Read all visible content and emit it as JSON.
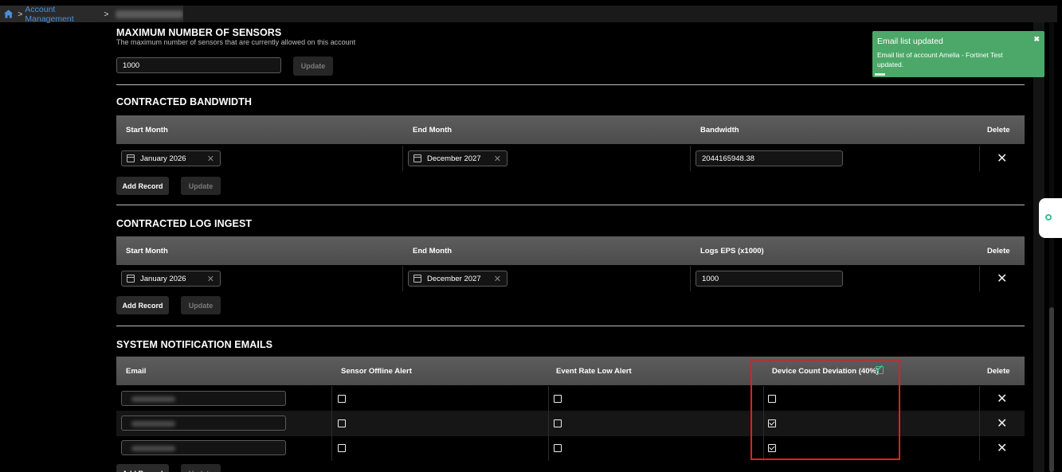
{
  "breadcrumb": {
    "home_icon": "home-icon",
    "separator": ">",
    "items": [
      "Account Management"
    ]
  },
  "max_sensors": {
    "title": "MAXIMUM NUMBER OF SENSORS",
    "subtitle": "The maximum number of sensors that are currently allowed on this account",
    "value": "1000",
    "update_label": "Update"
  },
  "bandwidth": {
    "title": "CONTRACTED BANDWIDTH",
    "columns": [
      "Start Month",
      "End Month",
      "Bandwidth",
      "Delete"
    ],
    "row": {
      "start": "January 2026",
      "end": "December 2027",
      "value": "2044165948.38"
    },
    "add_label": "Add Record",
    "update_label": "Update"
  },
  "log_ingest": {
    "title": "CONTRACTED LOG INGEST",
    "columns": [
      "Start Month",
      "End Month",
      "Logs EPS (x1000)",
      "Delete"
    ],
    "row": {
      "start": "January 2026",
      "end": "December 2027",
      "value": "1000"
    },
    "add_label": "Add Record",
    "update_label": "Update"
  },
  "emails": {
    "title": "SYSTEM NOTIFICATION EMAILS",
    "columns": [
      "Email",
      "Sensor Offline Alert",
      "Event Rate Low Alert",
      "Device Count Deviation (40%)",
      "Delete"
    ],
    "rows": [
      {
        "sensor_offline": false,
        "event_rate_low": false,
        "device_count": false
      },
      {
        "sensor_offline": false,
        "event_rate_low": false,
        "device_count": true
      },
      {
        "sensor_offline": false,
        "event_rate_low": false,
        "device_count": true
      }
    ],
    "add_label": "Add Record",
    "update_label": "Update"
  },
  "toast": {
    "title": "Email list updated",
    "body": "Email list of account Amelia - Fortinet Test updated.",
    "close": "✖",
    "color": "#4ca869"
  },
  "delete_glyph": "✕",
  "colors": {
    "accent": "#4a90d9",
    "highlight": "#e0201a",
    "success": "#4ca869"
  }
}
